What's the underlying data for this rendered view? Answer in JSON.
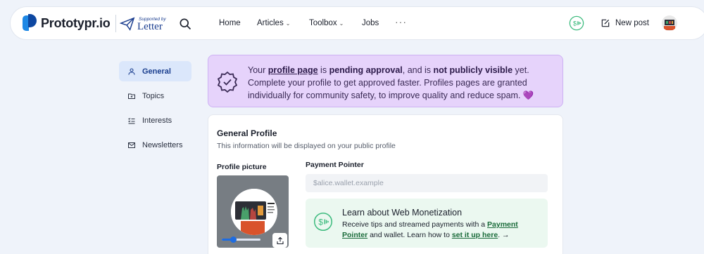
{
  "nav": {
    "brand": "Prototypr.io",
    "supported_by": "Supported by",
    "partner": "Letter",
    "items": [
      {
        "label": "Home",
        "dropdown": false
      },
      {
        "label": "Articles",
        "dropdown": true
      },
      {
        "label": "Toolbox",
        "dropdown": true
      },
      {
        "label": "Jobs",
        "dropdown": false
      }
    ],
    "more": "···",
    "new_post": "New post"
  },
  "sidebar": {
    "items": [
      {
        "label": "General",
        "icon": "user-icon",
        "active": true
      },
      {
        "label": "Topics",
        "icon": "folder-icon",
        "active": false
      },
      {
        "label": "Interests",
        "icon": "checklist-icon",
        "active": false
      },
      {
        "label": "Newsletters",
        "icon": "mail-icon",
        "active": false
      }
    ]
  },
  "banner": {
    "t1": "Your ",
    "link": "profile page",
    "t2": " is ",
    "b1": "pending approval",
    "t3": ", and is ",
    "b2": "not publicly visible",
    "t4": " yet. Complete your profile to get approved faster. Profiles pages are granted individually for community safety, to improve quality and reduce spam. ",
    "emoji": "💜"
  },
  "card": {
    "title": "General Profile",
    "subtitle": "This information will be displayed on your public profile",
    "picture_label": "Profile picture",
    "zoom_fraction": 0.3,
    "payment_label": "Payment Pointer",
    "payment_placeholder": "$alice.wallet.example",
    "payment_value": "",
    "monetization": {
      "title": "Learn about Web Monetization",
      "t1": "Receive tips and streamed payments with a ",
      "link1": "Payment Pointer",
      "t2": " and wallet. Learn how to ",
      "link2": "set it up here",
      "t3": ". →"
    }
  },
  "colors": {
    "accent": "#1e6ce0",
    "banner_bg": "#e6d3fb",
    "monetization_bg": "#ebf8f0",
    "active_nav_bg": "#dbe7fb"
  }
}
